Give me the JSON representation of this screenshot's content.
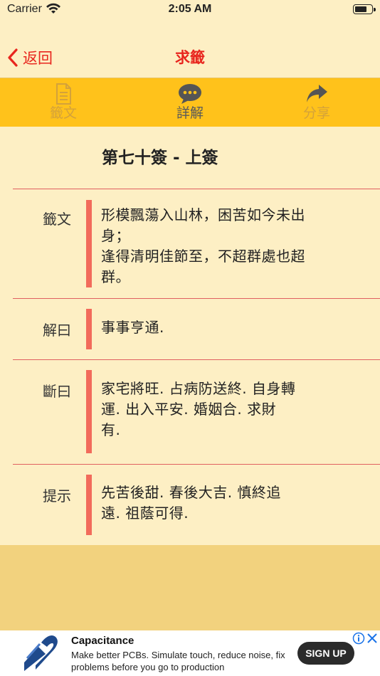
{
  "status_bar": {
    "carrier": "Carrier",
    "time": "2:05 AM"
  },
  "nav": {
    "back_label": "返回",
    "title": "求籤",
    "accent_color": "#E8261E"
  },
  "toolbar": {
    "background": "#FFC21B",
    "items": [
      {
        "label": "籤文",
        "icon": "document-icon",
        "state": "disabled"
      },
      {
        "label": "詳解",
        "icon": "speech-bubble-icon",
        "state": "active"
      },
      {
        "label": "分享",
        "icon": "share-arrow-icon",
        "state": "disabled"
      }
    ]
  },
  "lot": {
    "heading": "第七十簽 - 上簽",
    "rows": [
      {
        "label": "籤文",
        "lines": [
          "形模飄蕩入山林，困苦如今未出",
          "身；",
          "逢得清明佳節至，不超群處也超",
          "群。"
        ]
      },
      {
        "label": "解曰",
        "lines": [
          "事事亨通."
        ]
      },
      {
        "label": "斷曰",
        "lines": [
          "家宅將旺.  占病防送終.  自身轉",
          "運.  出入平安.  婚姻合.  求財",
          "有."
        ]
      },
      {
        "label": "提示",
        "lines": [
          "先苦後甜.  春後大吉.  慎終追",
          "遠.  祖蔭可得."
        ]
      }
    ]
  },
  "ad": {
    "title": "Capacitance",
    "body": "Make better PCBs. Simulate touch, reduce noise, fix problems before you go to production",
    "cta": "SIGN UP"
  }
}
